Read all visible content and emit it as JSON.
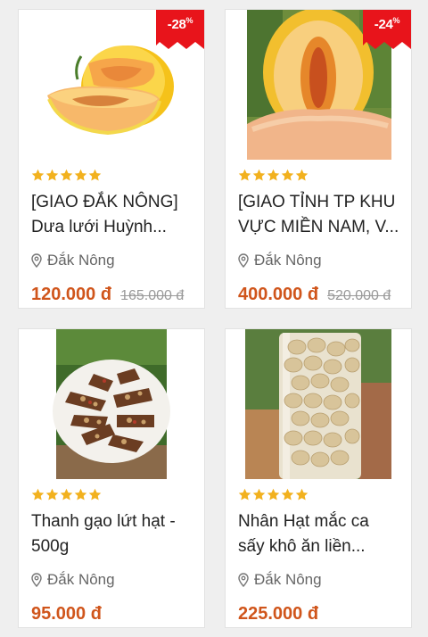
{
  "colors": {
    "price": "#d0551b",
    "badge": "#e8141b",
    "star": "#f2b11e"
  },
  "products": [
    {
      "image": "melon-yellow-sliced",
      "discount": "-28",
      "discount_unit": "%",
      "rating_stars": 5,
      "title_line1": "[GIAO ĐẮK NÔNG]",
      "title_line2": "Dưa lưới Huỳnh...",
      "location": "Đắk Nông",
      "price": "120.000 đ",
      "old_price": "165.000 đ"
    },
    {
      "image": "melon-cut-open",
      "discount": "-24",
      "discount_unit": "%",
      "rating_stars": 5,
      "title_line1": "[GIAO TỈNH TP KHU",
      "title_line2": "VỰC MIỀN NAM, V...",
      "location": "Đắk Nông",
      "price": "400.000 đ",
      "old_price": "520.000 đ"
    },
    {
      "image": "rice-nut-bars-plate",
      "rating_stars": 5,
      "title_line1": "Thanh gạo lứt hạt -",
      "title_line2": "500g",
      "location": "Đắk Nông",
      "price": "95.000 đ"
    },
    {
      "image": "macadamia-jar",
      "rating_stars": 5,
      "title_line1": "Nhân Hạt mắc ca",
      "title_line2": "sấy khô ăn liền...",
      "location": "Đắk Nông",
      "price": "225.000 đ"
    }
  ]
}
